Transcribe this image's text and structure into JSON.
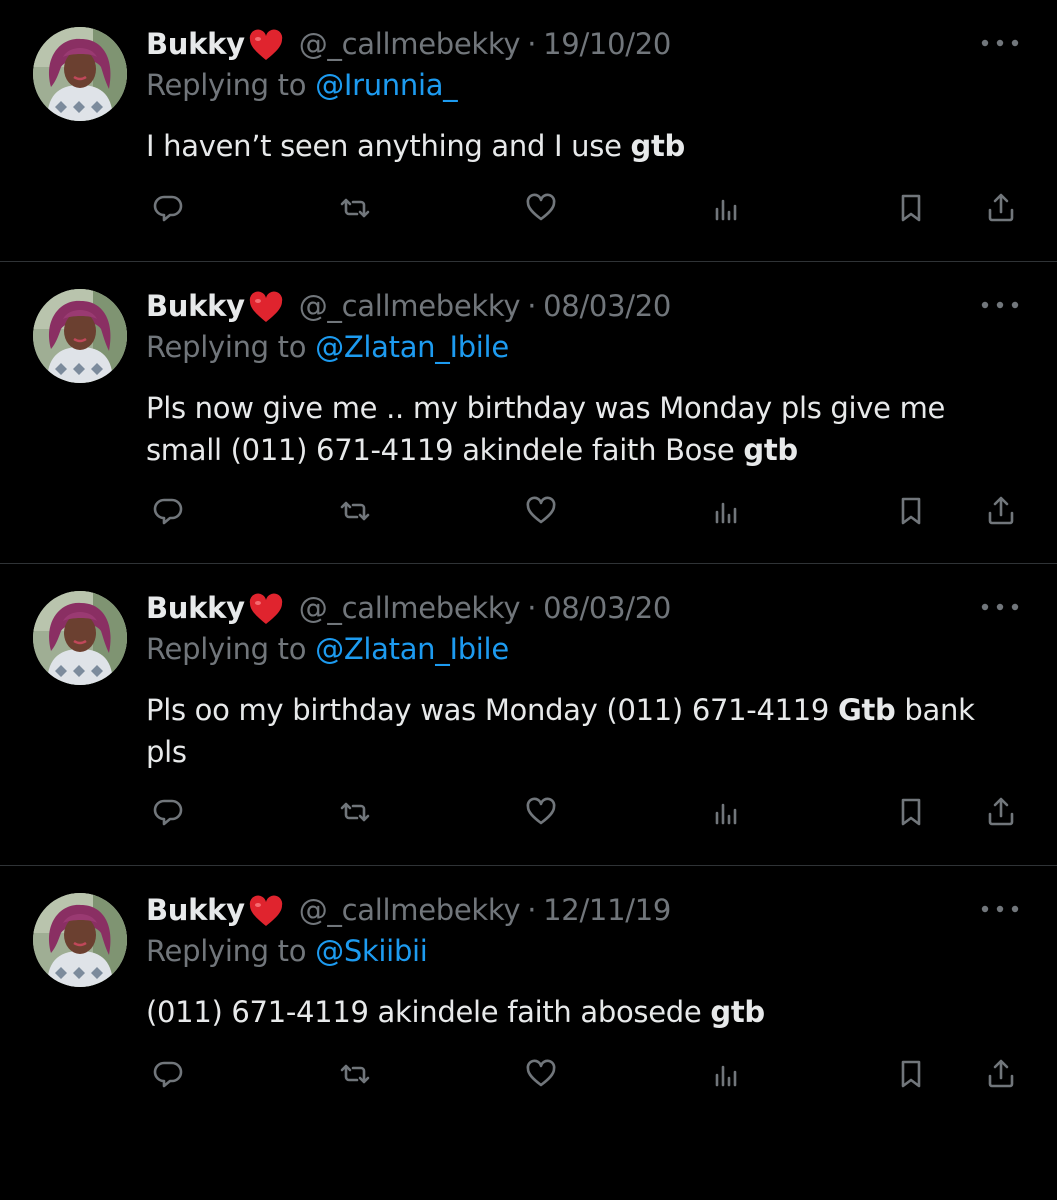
{
  "colors": {
    "background": "#000000",
    "text_primary": "#e7e9ea",
    "text_secondary": "#71767b",
    "link": "#1d9bf0",
    "divider": "#2f3336",
    "heart": "#e0242e"
  },
  "reply_prefix": "Replying to ",
  "tweets": [
    {
      "display_name": "Bukky",
      "name_emoji": "red-heart",
      "handle": "@_callmebekky",
      "separator": "·",
      "date": "19/10/20",
      "replying_to": "@Irunnia_",
      "text_before": "I haven’t seen anything  and I use ",
      "text_bold": "gtb",
      "text_after": "",
      "icons": [
        "reply-icon",
        "retweet-icon",
        "like-icon",
        "views-icon",
        "bookmark-icon",
        "share-icon",
        "more-icon"
      ]
    },
    {
      "display_name": "Bukky",
      "name_emoji": "red-heart",
      "handle": "@_callmebekky",
      "separator": "·",
      "date": "08/03/20",
      "replying_to": "@Zlatan_Ibile",
      "text_before": "Pls now give me .. my birthday was Monday pls give me small (011) 671-4119 akindele faith Bose ",
      "text_bold": "gtb",
      "text_after": "",
      "icons": [
        "reply-icon",
        "retweet-icon",
        "like-icon",
        "views-icon",
        "bookmark-icon",
        "share-icon",
        "more-icon"
      ]
    },
    {
      "display_name": "Bukky",
      "name_emoji": "red-heart",
      "handle": "@_callmebekky",
      "separator": "·",
      "date": "08/03/20",
      "replying_to": "@Zlatan_Ibile",
      "text_before": "Pls oo my birthday was Monday (011) 671-4119 ",
      "text_bold": "Gtb",
      "text_after": " bank pls",
      "icons": [
        "reply-icon",
        "retweet-icon",
        "like-icon",
        "views-icon",
        "bookmark-icon",
        "share-icon",
        "more-icon"
      ]
    },
    {
      "display_name": "Bukky",
      "name_emoji": "red-heart",
      "handle": "@_callmebekky",
      "separator": "·",
      "date": "12/11/19",
      "replying_to": "@Skiibii",
      "text_before": "(011) 671-4119 akindele faith abosede ",
      "text_bold": "gtb",
      "text_after": "",
      "icons": [
        "reply-icon",
        "retweet-icon",
        "like-icon",
        "views-icon",
        "bookmark-icon",
        "share-icon",
        "more-icon"
      ]
    }
  ]
}
